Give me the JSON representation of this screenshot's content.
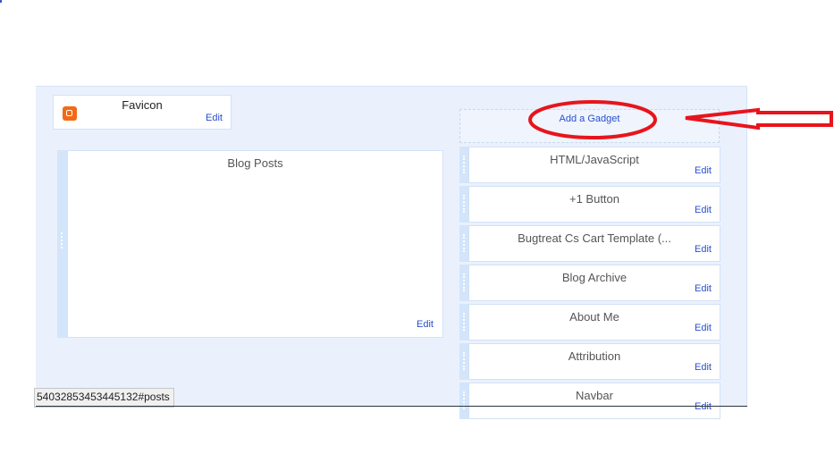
{
  "favicon": {
    "title": "Favicon",
    "edit": "Edit",
    "icon": "blogger-icon"
  },
  "blog_posts": {
    "title": "Blog Posts",
    "edit": "Edit"
  },
  "add_gadget": "Add a Gadget",
  "gadgets": [
    {
      "title": "HTML/JavaScript",
      "edit": "Edit"
    },
    {
      "title": "+1 Button",
      "edit": "Edit"
    },
    {
      "title": "Bugtreat Cs Cart Template (...",
      "edit": "Edit"
    },
    {
      "title": "Blog Archive",
      "edit": "Edit"
    },
    {
      "title": "About Me",
      "edit": "Edit"
    },
    {
      "title": "Attribution",
      "edit": "Edit"
    },
    {
      "title": "Navbar",
      "edit": "Edit"
    }
  ],
  "status_url": "5403285345344513​2#posts",
  "annotation_color": "#e8141c"
}
